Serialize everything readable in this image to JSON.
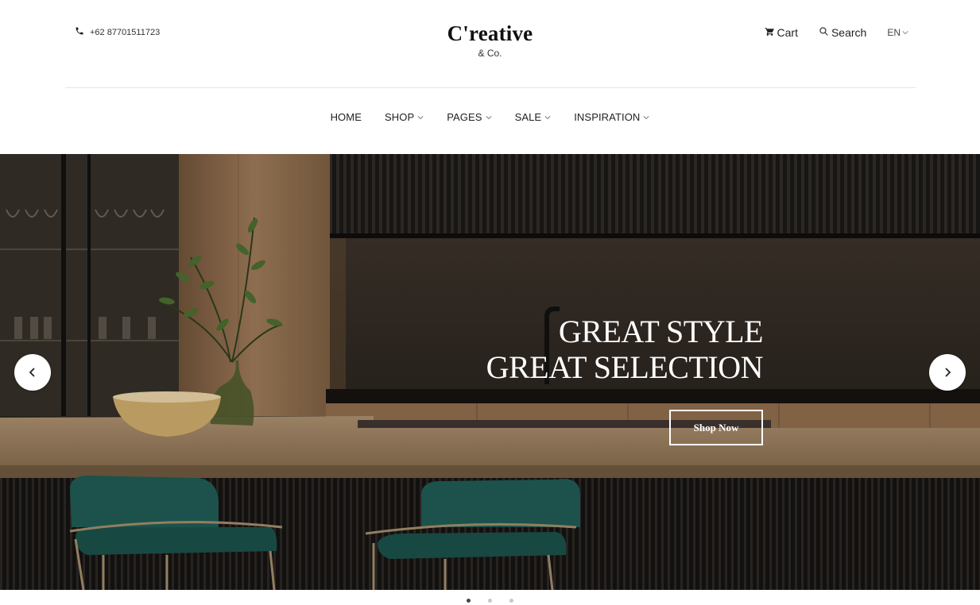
{
  "header": {
    "phone": "+62 87701511723",
    "brand_name": "C'reative",
    "brand_sub": "& Co.",
    "cart_label": "Cart",
    "search_label": "Search",
    "language": "EN"
  },
  "nav": {
    "items": [
      {
        "label": "HOME",
        "has_dropdown": false
      },
      {
        "label": "SHOP",
        "has_dropdown": true
      },
      {
        "label": "PAGES",
        "has_dropdown": true
      },
      {
        "label": "SALE",
        "has_dropdown": true
      },
      {
        "label": "INSPIRATION",
        "has_dropdown": true
      }
    ]
  },
  "hero": {
    "title_line1": "GREAT STYLE",
    "title_line2": "GREAT SELECTION",
    "cta_label": "Shop Now",
    "slide_count": 3,
    "active_slide": 1
  },
  "icons": {
    "phone": "phone-icon",
    "cart": "cart-icon",
    "search": "search-icon",
    "prev": "chevron-left-icon",
    "next": "chevron-right-icon"
  },
  "colors": {
    "chair_green": "#1f5a52",
    "wood": "#8a6a4a",
    "cabinet_dark": "#1e1b18"
  }
}
